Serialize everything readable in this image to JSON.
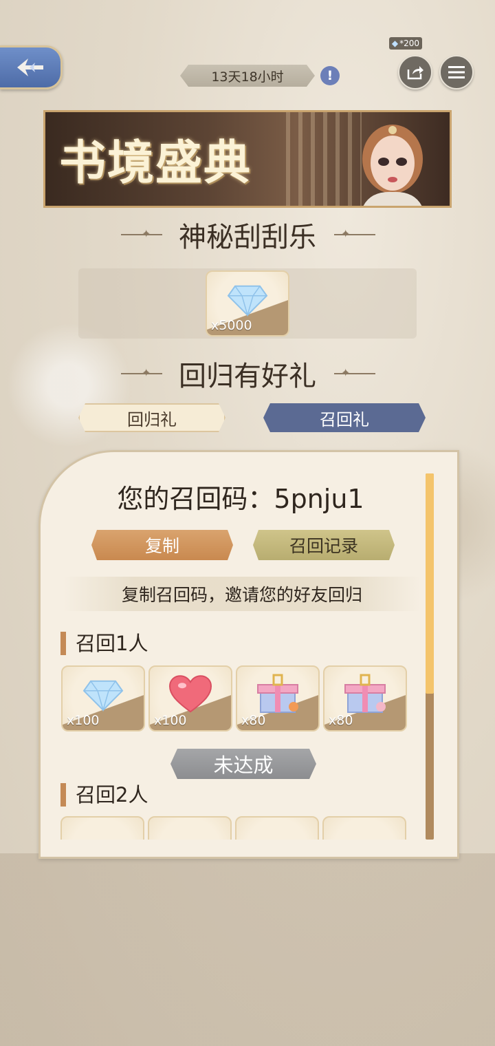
{
  "header": {
    "timer": "13天18小时",
    "share_badge_count": "*200",
    "icons": [
      "back-arrow-icon",
      "info-icon",
      "share-icon",
      "menu-icon"
    ]
  },
  "banner": {
    "title": "书境盛典"
  },
  "scratch": {
    "title": "神秘刮刮乐",
    "reward": {
      "icon": "diamond-icon",
      "qty": "x5000"
    }
  },
  "returns": {
    "title": "回归有好礼",
    "tabs": [
      {
        "label": "回归礼",
        "active": false
      },
      {
        "label": "召回礼",
        "active": true
      }
    ]
  },
  "panel": {
    "recall_code_label": "您的召回码：5pnju1",
    "copy_button": "复制",
    "record_button": "召回记录",
    "hint": "复制召回码，邀请您的好友回归",
    "tiers": [
      {
        "title": "召回1人",
        "rewards": [
          {
            "icon": "diamond-icon",
            "qty": "x100"
          },
          {
            "icon": "heart-icon",
            "qty": "x100"
          },
          {
            "icon": "gift-box-icon",
            "qty": "x80"
          },
          {
            "icon": "gift-box-icon",
            "qty": "x80"
          }
        ],
        "status": "未达成"
      },
      {
        "title": "召回2人",
        "rewards": [
          {
            "icon": "diamond-icon"
          },
          {
            "icon": "coin-icon"
          },
          {
            "icon": "gift-box-icon"
          },
          {
            "icon": "flower-icon"
          }
        ]
      }
    ]
  },
  "colors": {
    "accent_blue": "#5b6a93",
    "accent_gold": "#f4c46b",
    "copy_orange": "#d9a36e"
  }
}
